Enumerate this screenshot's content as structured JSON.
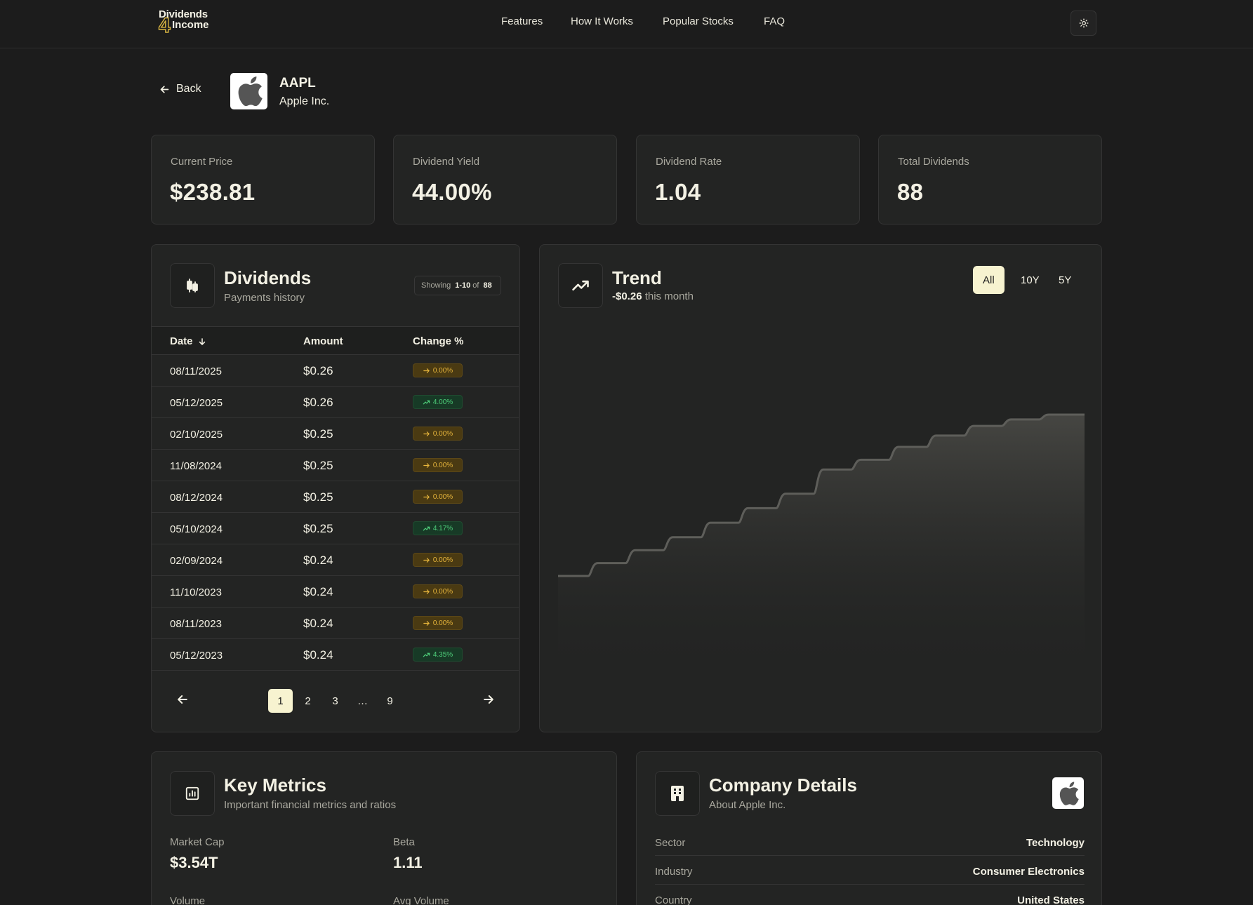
{
  "brand": {
    "line1": "Dividends",
    "digit": "4",
    "line2": "Income"
  },
  "nav": {
    "items": [
      "Features",
      "How It Works",
      "Popular Stocks",
      "FAQ"
    ]
  },
  "header": {
    "back_label": "Back",
    "ticker": "AAPL",
    "company_name": "Apple Inc."
  },
  "stats": [
    {
      "label": "Current Price",
      "value": "$238.81"
    },
    {
      "label": "Dividend Yield",
      "value": "44.00%"
    },
    {
      "label": "Dividend Rate",
      "value": "1.04"
    },
    {
      "label": "Total Dividends",
      "value": "88"
    }
  ],
  "dividends": {
    "title": "Dividends",
    "subtitle": "Payments history",
    "showing_prefix": "Showing",
    "showing_range": "1-10",
    "showing_of": "of",
    "showing_total": "88",
    "columns": [
      "Date",
      "Amount",
      "Change %"
    ],
    "rows": [
      {
        "date": "08/11/2025",
        "amount": "$0.26",
        "change": "0.00%",
        "trend": "flat"
      },
      {
        "date": "05/12/2025",
        "amount": "$0.26",
        "change": "4.00%",
        "trend": "up"
      },
      {
        "date": "02/10/2025",
        "amount": "$0.25",
        "change": "0.00%",
        "trend": "flat"
      },
      {
        "date": "11/08/2024",
        "amount": "$0.25",
        "change": "0.00%",
        "trend": "flat"
      },
      {
        "date": "08/12/2024",
        "amount": "$0.25",
        "change": "0.00%",
        "trend": "flat"
      },
      {
        "date": "05/10/2024",
        "amount": "$0.25",
        "change": "4.17%",
        "trend": "up"
      },
      {
        "date": "02/09/2024",
        "amount": "$0.24",
        "change": "0.00%",
        "trend": "flat"
      },
      {
        "date": "11/10/2023",
        "amount": "$0.24",
        "change": "0.00%",
        "trend": "flat"
      },
      {
        "date": "08/11/2023",
        "amount": "$0.24",
        "change": "0.00%",
        "trend": "flat"
      },
      {
        "date": "05/12/2023",
        "amount": "$0.24",
        "change": "4.35%",
        "trend": "up"
      }
    ],
    "pagination": {
      "pages": [
        "1",
        "2",
        "3",
        "…",
        "9"
      ],
      "current": "1"
    }
  },
  "trend": {
    "title": "Trend",
    "change_value": "-$0.26",
    "change_suffix": "this month",
    "ranges": [
      "All",
      "10Y",
      "5Y"
    ],
    "active_range": "All",
    "line_color": "#5e5e5a",
    "step_levels": [
      0.0,
      0.08,
      0.16,
      0.24,
      0.33,
      0.42,
      0.51,
      0.66,
      0.72,
      0.8,
      0.87,
      0.93,
      0.97,
      1.0
    ]
  },
  "key_metrics": {
    "title": "Key Metrics",
    "subtitle": "Important financial metrics and ratios",
    "items": [
      {
        "label": "Market Cap",
        "value": "$3.54T"
      },
      {
        "label": "Beta",
        "value": "1.11"
      },
      {
        "label": "Volume",
        "value": ""
      },
      {
        "label": "Avg Volume",
        "value": ""
      }
    ]
  },
  "company_details": {
    "title": "Company Details",
    "subtitle": "About Apple Inc.",
    "rows": [
      {
        "label": "Sector",
        "value": "Technology"
      },
      {
        "label": "Industry",
        "value": "Consumer Electronics"
      },
      {
        "label": "Country",
        "value": "United States"
      }
    ]
  }
}
